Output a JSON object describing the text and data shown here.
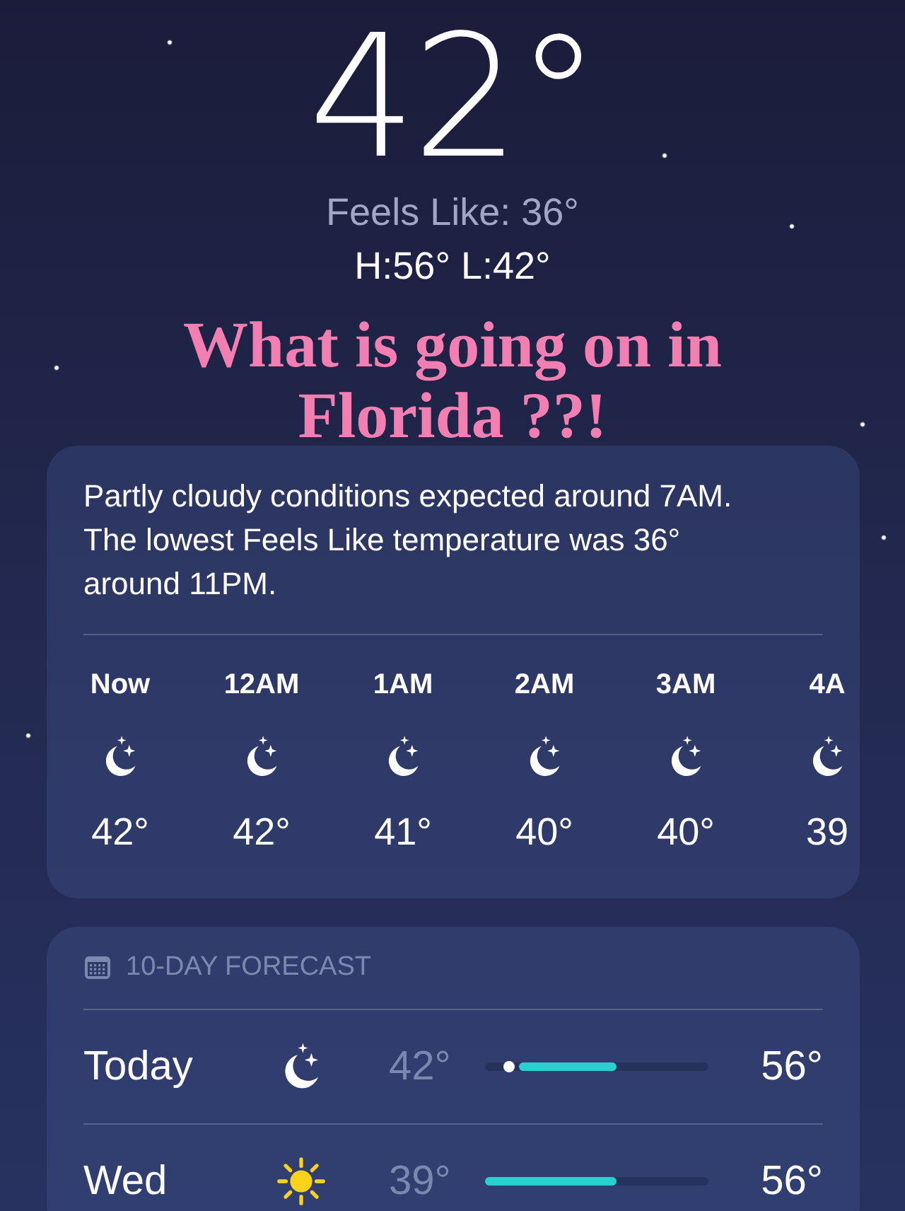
{
  "current": {
    "temperature": "42°",
    "feels_like": "Feels Like: 36°",
    "high_low": "H:56°  L:42°"
  },
  "caption": "What is going on in Florida ??!",
  "hourly": {
    "summary": "Partly cloudy conditions expected around 7AM. The lowest Feels Like temperature was 36° around 11PM.",
    "hours": [
      {
        "time": "Now",
        "temp": "42°"
      },
      {
        "time": "12AM",
        "temp": "42°"
      },
      {
        "time": "1AM",
        "temp": "41°"
      },
      {
        "time": "2AM",
        "temp": "40°"
      },
      {
        "time": "3AM",
        "temp": "40°"
      },
      {
        "time": "4A",
        "temp": "39"
      }
    ]
  },
  "forecast": {
    "title": "10-DAY FORECAST",
    "days": [
      {
        "day": "Today",
        "kind": "night",
        "low": "42°",
        "high": "56°",
        "current": {
          "level": 0.11
        }
      },
      {
        "day": "Wed",
        "kind": "sunny",
        "low": "39°",
        "high": "56°"
      }
    ]
  }
}
